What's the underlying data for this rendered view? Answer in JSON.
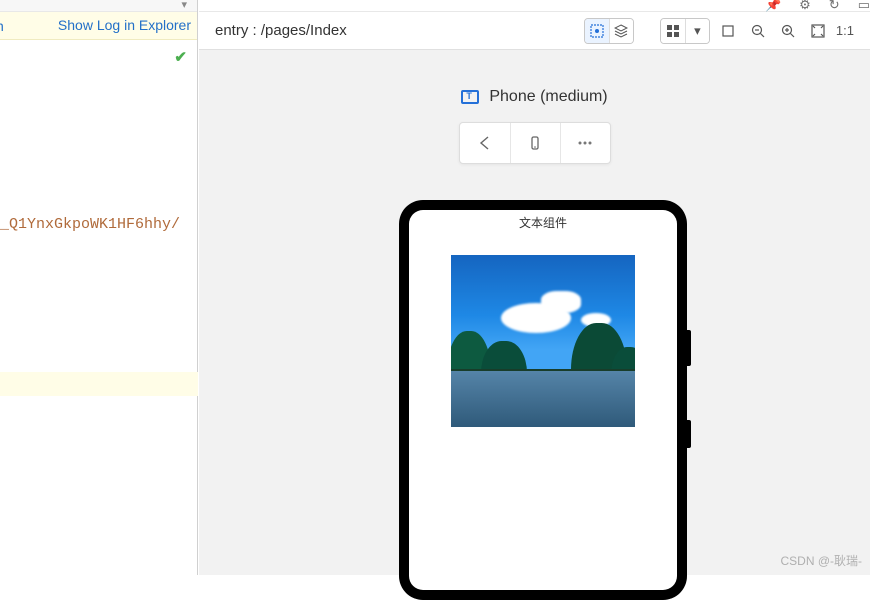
{
  "left": {
    "first_fragment": "n",
    "show_log": "Show Log in Explorer",
    "code_fragment": "_Q1YnxGkpoWK1HF6hhy/"
  },
  "header": {
    "entry_path": "entry : /pages/Index"
  },
  "device": {
    "label": "Phone (medium)"
  },
  "app": {
    "text_component": "文本组件"
  },
  "zoom": {
    "ratio": "1:1"
  },
  "watermark": "CSDN @-耿瑞-"
}
